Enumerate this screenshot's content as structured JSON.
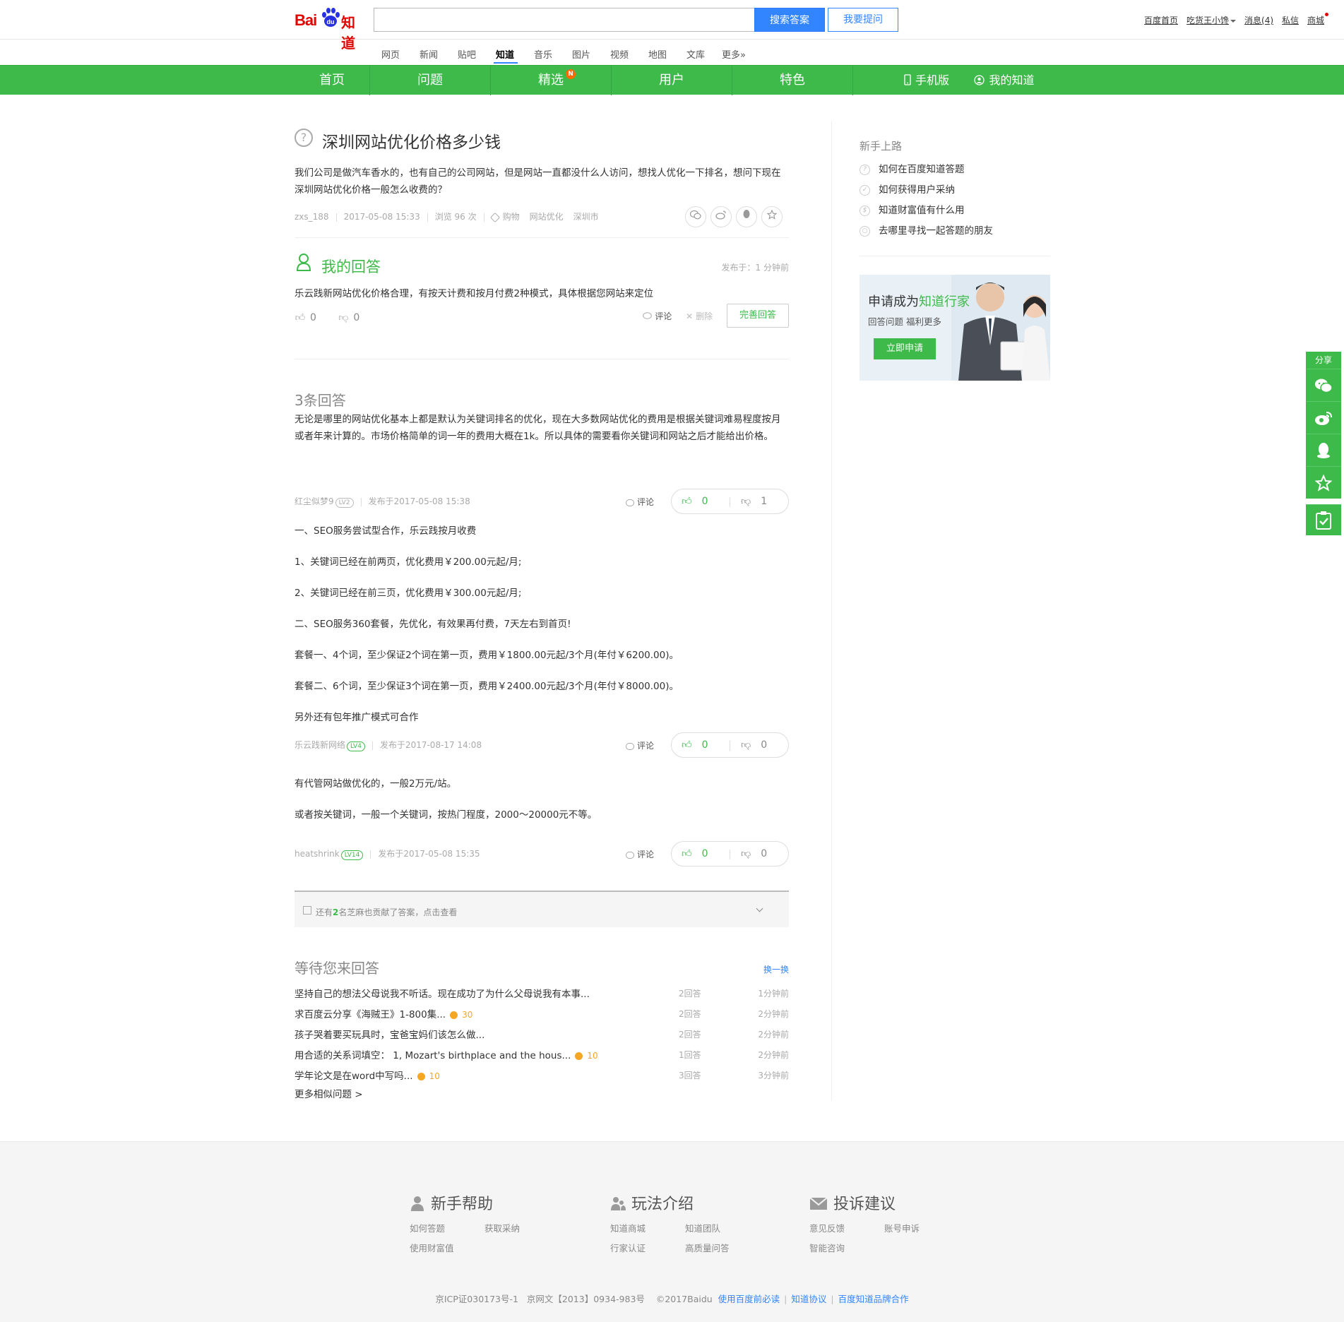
{
  "header": {
    "logo_bai": "Bai",
    "logo_du": "du",
    "logo_zhidao": "知道",
    "search_placeholder": "",
    "search_button": "搜索答案",
    "ask_button": "我要提问",
    "user_links": [
      "百度首页",
      "吃货王小馋",
      "消息(4)",
      "私信",
      "商城"
    ]
  },
  "channels": [
    "网页",
    "新闻",
    "贴吧",
    "知道",
    "音乐",
    "图片",
    "视频",
    "地图",
    "文库",
    "更多»"
  ],
  "active_channel": "知道",
  "nav": {
    "items": [
      "首页",
      "问题",
      "精选",
      "用户",
      "特色"
    ],
    "badge": "N",
    "right_items": [
      "手机版",
      "我的知道"
    ]
  },
  "question": {
    "title": "深圳网站优化价格多少钱",
    "description": "我们公司是做汽车香水的，也有自己的公司网站，但是网站一直都没什么人访问，想找人优化一下排名，想问下现在深圳网站优化价格一般怎么收费的？",
    "asker": "zxs_188",
    "date": "2017-05-08 15:33",
    "views": "浏览 96 次",
    "tags": [
      "购物",
      "网站优化",
      "深圳市"
    ]
  },
  "my_answer": {
    "title": "我的回答",
    "time": "发布于：1 分钟前",
    "text": "乐云践新网站优化价格合理，有按天计费和按月付费2种模式，具体根据您网站来定位",
    "likes": "0",
    "dislikes": "0",
    "comment_label": "评论",
    "delete_label": "删除",
    "improve_button": "完善回答"
  },
  "answers_header": "3条回答",
  "answers": [
    {
      "paragraphs": [
        "无论是哪里的网站优化基本上都是默认为关键词排名的优化，现在大多数网站优化的费用是根据关键词难易程度按月或者年来计算的。市场价格简单的词一年的费用大概在1k。所以具体的需要看你关键词和网站之后才能给出价格。"
      ],
      "author": "红尘似梦9",
      "level": "LV2",
      "time": "发布于2017-05-08 15:38",
      "comment": "评论",
      "up": "0",
      "down": "1"
    },
    {
      "paragraphs": [
        "一、SEO服务尝试型合作，乐云践按月收费",
        "1、关键词已经在前两页，优化费用￥200.00元起/月;",
        "2、关键词已经在前三页，优化费用￥300.00元起/月;",
        "二、SEO服务360套餐，先优化，有效果再付费，7天左右到首页!",
        "套餐一、4个词，至少保证2个词在第一页，费用￥1800.00元起/3个月(年付￥6200.00)。",
        "套餐二、6个词，至少保证3个词在第一页，费用￥2400.00元起/3个月(年付￥8000.00)。",
        "另外还有包年推广模式可合作"
      ],
      "author": "乐云践新网络",
      "level": "LV4",
      "time": "发布于2017-08-17 14:08",
      "comment": "评论",
      "up": "0",
      "down": "0"
    },
    {
      "paragraphs": [
        "有代管网站做优化的，一般2万元/站。",
        "或者按关键词，一般一个关键词，按热门程度，2000～20000元不等。"
      ],
      "author": "heatshrink",
      "level": "LV14",
      "time": "发布于2017-05-08 15:35",
      "comment": "评论",
      "up": "0",
      "down": "0"
    }
  ],
  "more_answers": {
    "prefix": "还有",
    "count": "2",
    "suffix": "名芝麻也贡献了答案，点击查看"
  },
  "waiting": {
    "title": "等待您来回答",
    "refresh": "换一换",
    "rows": [
      {
        "q": "坚持自己的想法父母说我不听话。现在成功了为什么父母说我有本事...",
        "reward": "",
        "count": "2回答",
        "time": "1分钟前"
      },
      {
        "q": "求百度云分享《海贼王》1-800集...",
        "reward": "30",
        "count": "2回答",
        "time": "2分钟前"
      },
      {
        "q": "孩子哭着要买玩具时，宝爸宝妈们该怎么做...",
        "reward": "",
        "count": "2回答",
        "time": "2分钟前"
      },
      {
        "q": "用合适的关系词填空： 1, Mozart's birthplace and the hous...",
        "reward": "10",
        "count": "1回答",
        "time": "2分钟前"
      },
      {
        "q": "学年论文是在word中写吗...",
        "reward": "10",
        "count": "3回答",
        "time": "3分钟前"
      }
    ],
    "more": "更多相似问题 >"
  },
  "sidebar": {
    "title": "新手上路",
    "links": [
      "如何在百度知道答题",
      "如何获得用户采纳",
      "知道财富值有什么用",
      "去哪里寻找一起答题的朋友"
    ],
    "banner_prefix": "申请成为",
    "banner_highlight": "知道行家",
    "banner_sub": "回答问题  福利更多",
    "banner_button": "立即申请"
  },
  "float_share": {
    "label": "分享"
  },
  "footer": {
    "cols": [
      {
        "title": "新手帮助",
        "links": [
          "如何答题",
          "获取采纳",
          "使用财富值"
        ]
      },
      {
        "title": "玩法介绍",
        "links": [
          "知道商城",
          "知道团队",
          "行家认证",
          "高质量问答"
        ]
      },
      {
        "title": "投诉建议",
        "links": [
          "意见反馈",
          "账号申诉",
          "智能咨询"
        ]
      }
    ],
    "icp": "京ICP证030173号-1",
    "netculture": "京网文【2013】0934-983号",
    "copyright": "©2017Baidu",
    "links": [
      "使用百度前必读",
      "知道协议",
      "百度知道品牌合作"
    ]
  },
  "colors": {
    "green": "#3dba49",
    "blue": "#3385ff",
    "orange": "#f5a623",
    "red": "#e10602"
  }
}
